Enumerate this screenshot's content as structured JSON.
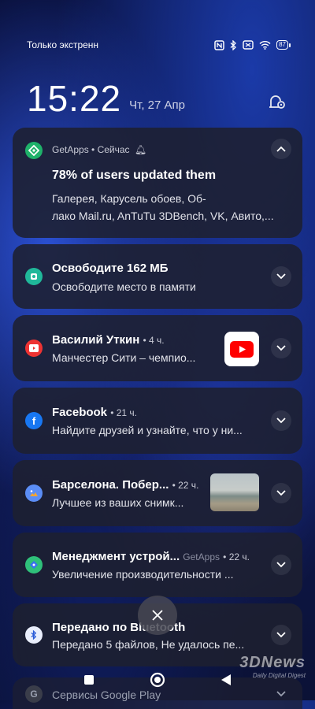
{
  "status_bar": {
    "left_text": "Только экстренн",
    "battery": "87"
  },
  "header": {
    "time": "15:22",
    "date": "Чт, 27 Апр"
  },
  "notifications": [
    {
      "app": "GetApps",
      "meta": "• Сейчас",
      "title": "78% of users updated them",
      "body_line1": "Галерея, Карусель обоев, Об-",
      "body_line2": "лако Mail.ru, AnTuTu 3DBench, VK, Авито,..."
    },
    {
      "title": "Освободите 162 МБ",
      "body": "Освободите место в памяти"
    },
    {
      "title": "Василий Уткин",
      "meta": "• 4 ч.",
      "body": "Манчестер Сити – чемпио..."
    },
    {
      "title": "Facebook",
      "meta": "• 21 ч.",
      "body": "Найдите друзей и узнайте, что у ни..."
    },
    {
      "title": "Барселона. Побер...",
      "meta": "• 22 ч.",
      "body": "Лучшее из ваших снимк..."
    },
    {
      "title": "Менеджмент устрой...",
      "app": "GetApps",
      "meta": "• 22 ч.",
      "body": "Увеличение производительности ..."
    },
    {
      "title": "Передано по Bluetooth",
      "body": "Передано 5 файлов, Не удалось пе..."
    },
    {
      "title": "Сервисы Google Play"
    }
  ],
  "watermark": {
    "logo": "3DNews",
    "sub": "Daily Digital Digest"
  },
  "icons": [
    "nfc-icon",
    "bluetooth-icon",
    "sim-icon",
    "wifi-icon",
    "battery-icon",
    "settings-icon",
    "chevron-icon",
    "close-icon"
  ]
}
